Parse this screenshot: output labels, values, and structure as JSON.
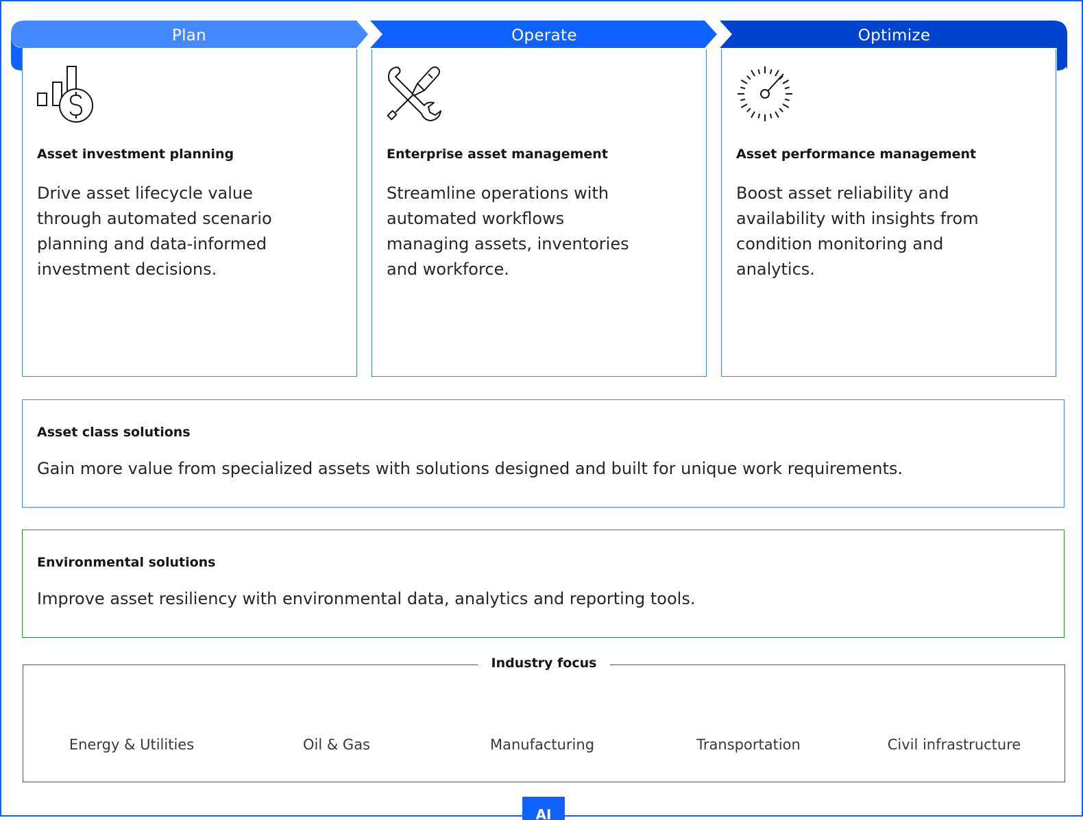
{
  "colors": {
    "plan": "#4589ff",
    "operate": "#0f62fe",
    "optimize": "#0043ce",
    "card_border": "#4a7bf5",
    "environment_border": "#2e8b3a",
    "industry_border": "#525252"
  },
  "phases": [
    {
      "label": "Plan",
      "icon": "bar-chart-dollar-icon",
      "title": "Asset investment planning",
      "body": "Drive asset lifecycle value through automated scenario planning and data-informed investment decisions."
    },
    {
      "label": "Operate",
      "icon": "wrench-screwdriver-icon",
      "title": "Enterprise asset management",
      "body": "Streamline operations with automated workflows managing assets, inventories and workforce."
    },
    {
      "label": "Optimize",
      "icon": "gauge-icon",
      "title": "Asset performance management",
      "body": "Boost asset reliability and availability with insights from condition monitoring and analytics."
    }
  ],
  "asset_class": {
    "title": "Asset class solutions",
    "body": "Gain more value from specialized assets with solutions designed and built for unique work requirements."
  },
  "environmental": {
    "title": "Environmental solutions",
    "body": "Improve asset resiliency with environmental data, analytics and reporting tools."
  },
  "industry": {
    "title": "Industry focus",
    "items": [
      "Energy & Utilities",
      "Oil & Gas",
      "Manufacturing",
      "Transportation",
      "Civil infrastructure"
    ]
  },
  "bottom_tab": {
    "label": "AI"
  }
}
